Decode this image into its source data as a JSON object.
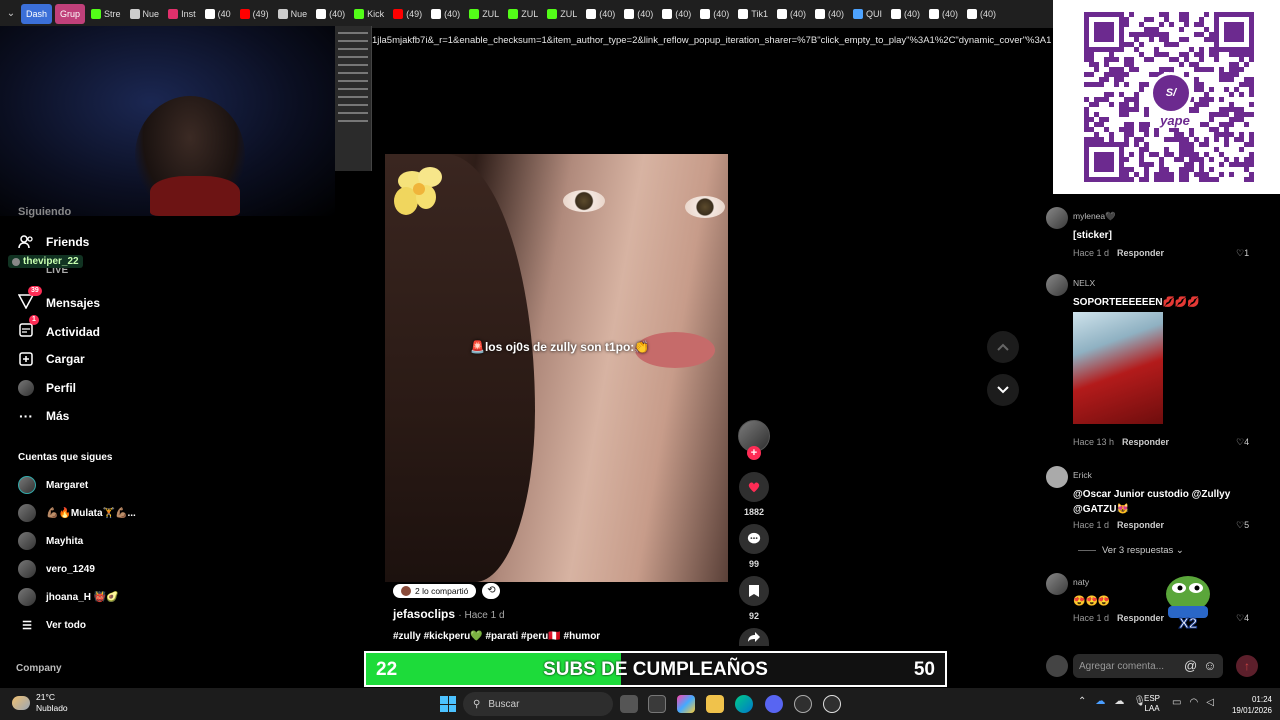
{
  "browser": {
    "tabs": [
      {
        "label": "Dash",
        "color": "#3b6fd8"
      },
      {
        "label": "Grup",
        "color": "#c0407a"
      },
      {
        "label": "Stre",
        "color": "#53fc18"
      },
      {
        "label": "Nue",
        "color": "#cccccc"
      },
      {
        "label": "Inst",
        "color": "#e1306c"
      },
      {
        "label": "(40",
        "color": "#ffffff"
      },
      {
        "label": "(49)",
        "color": "#ff0000"
      },
      {
        "label": "Nue",
        "color": "#cccccc"
      },
      {
        "label": "(40)",
        "color": "#ffffff"
      },
      {
        "label": "Kick",
        "color": "#53fc18"
      },
      {
        "label": "(49)",
        "color": "#ff0000"
      },
      {
        "label": "(40)",
        "color": "#ffffff"
      },
      {
        "label": "ZUL",
        "color": "#53fc18"
      },
      {
        "label": "ZUL",
        "color": "#53fc18"
      },
      {
        "label": "ZUL",
        "color": "#53fc18"
      },
      {
        "label": "(40)",
        "color": "#ffffff"
      },
      {
        "label": "(40)",
        "color": "#ffffff"
      },
      {
        "label": "(40)",
        "color": "#ffffff"
      },
      {
        "label": "(40)",
        "color": "#ffffff"
      },
      {
        "label": "Tik1",
        "color": "#ffffff"
      },
      {
        "label": "(40)",
        "color": "#ffffff"
      },
      {
        "label": "(40)",
        "color": "#ffffff"
      },
      {
        "label": "QUI",
        "color": "#4da3ff"
      },
      {
        "label": "(40)",
        "color": "#ffffff"
      },
      {
        "label": "(40)",
        "color": "#ffffff"
      },
      {
        "label": "(40)",
        "color": "#ffffff"
      }
    ],
    "url": "1jla5mjakfb7i&_r=1&enable_checksum=1&item_author_type=2&link_reflow_popup_iteration_sharer=%7B\"click_empty_to_play\"%3A1%2C\"dynamic_cover\"%3A1..."
  },
  "sidebar": {
    "partial_item": "Siguiendo",
    "friends": "Friends",
    "live": "LIVE",
    "viper_tag": "theviper_22",
    "messages": "Mensajes",
    "messages_badge": "39",
    "activity": "Actividad",
    "activity_badge": "1",
    "upload": "Cargar",
    "profile": "Perfil",
    "more": "Más",
    "following_title": "Cuentas que sigues",
    "following": [
      {
        "name": "Margaret"
      },
      {
        "name": "💪🏽🔥Mulata🏋️💪🏽..."
      },
      {
        "name": "Mayhita"
      },
      {
        "name": "vero_1249"
      },
      {
        "name": "jhoana_H 👹🥑"
      }
    ],
    "see_all": "Ver todo",
    "company": "Company"
  },
  "video": {
    "caption": "🚨los oj0s de zully son t1po:👏",
    "shared_pill": "2 lo compartió",
    "author": "jefasoclips",
    "posted": "· Hace 1 d",
    "tags": "#zully #kickperu💚 #parati #peru🇵🇪 #humor"
  },
  "actions": {
    "likes": "1882",
    "comments": "99",
    "saves": "92"
  },
  "comments": [
    {
      "user": "mylenea🖤",
      "text": "[sticker]",
      "time": "Hace 1 d",
      "reply": "Responder",
      "likes": "1"
    },
    {
      "user": "NELX",
      "text": "SOPORTEEEEEEN💋💋💋",
      "time": "Hace 13 h",
      "reply": "Responder",
      "likes": "4"
    },
    {
      "user": "Erick",
      "text": "@Oscar Junior custodio @Zullyy @GATZU😻",
      "time": "Hace 1 d",
      "reply": "Responder",
      "likes": "5"
    },
    {
      "user": "naty",
      "text": "😍😍😍",
      "time": "Hace 1 d",
      "reply": "Responder",
      "likes": "4"
    }
  ],
  "more_replies": "Ver 3 respuestas ⌄",
  "comment_input": {
    "placeholder": "Agregar comenta..."
  },
  "overlay": {
    "subs_current": "22",
    "subs_goal": "50",
    "subs_label": "SUBS DE CUMPLEAÑOS",
    "progress": 0.44,
    "qr_brand": "yape",
    "qr_badge": "S/",
    "emote_text": "X2"
  },
  "taskbar": {
    "temp": "21°C",
    "weather": "Nublado",
    "search_placeholder": "Buscar",
    "lang_top": "ESP",
    "lang_bottom": "LAA",
    "time": "01:24",
    "date": "19/01/2026"
  },
  "colors": {
    "tiktok_red": "#fe2c55",
    "subs_green": "#1ddb3a",
    "yape_purple": "#6c2a8f"
  }
}
